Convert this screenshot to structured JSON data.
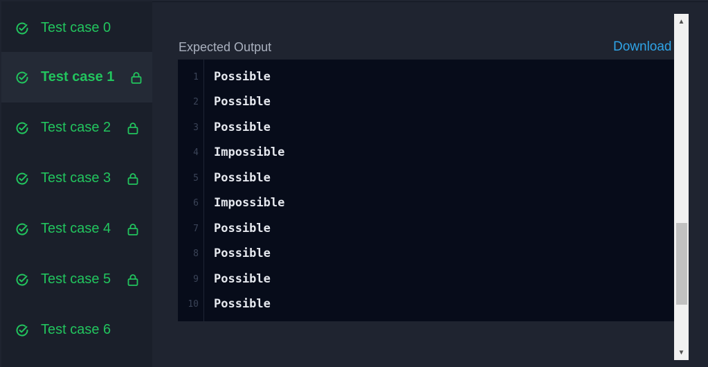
{
  "test_cases": [
    {
      "label": "Test case 0",
      "locked": false,
      "active": false
    },
    {
      "label": "Test case 1",
      "locked": true,
      "active": true
    },
    {
      "label": "Test case 2",
      "locked": true,
      "active": false
    },
    {
      "label": "Test case 3",
      "locked": true,
      "active": false
    },
    {
      "label": "Test case 4",
      "locked": true,
      "active": false
    },
    {
      "label": "Test case 5",
      "locked": true,
      "active": false
    },
    {
      "label": "Test case 6",
      "locked": false,
      "active": false
    }
  ],
  "output": {
    "title": "Expected Output",
    "download_label": "Download",
    "lines": [
      {
        "num": "1",
        "text": "Possible"
      },
      {
        "num": "2",
        "text": "Possible"
      },
      {
        "num": "3",
        "text": "Possible"
      },
      {
        "num": "4",
        "text": "Impossible"
      },
      {
        "num": "5",
        "text": "Possible"
      },
      {
        "num": "6",
        "text": "Impossible"
      },
      {
        "num": "7",
        "text": "Possible"
      },
      {
        "num": "8",
        "text": "Possible"
      },
      {
        "num": "9",
        "text": "Possible"
      },
      {
        "num": "10",
        "text": "Possible"
      }
    ]
  },
  "icons": {
    "check": "check-circle-icon",
    "lock": "lock-icon"
  },
  "colors": {
    "accent_green": "#22c55e",
    "link_blue": "#2fa4e7"
  }
}
